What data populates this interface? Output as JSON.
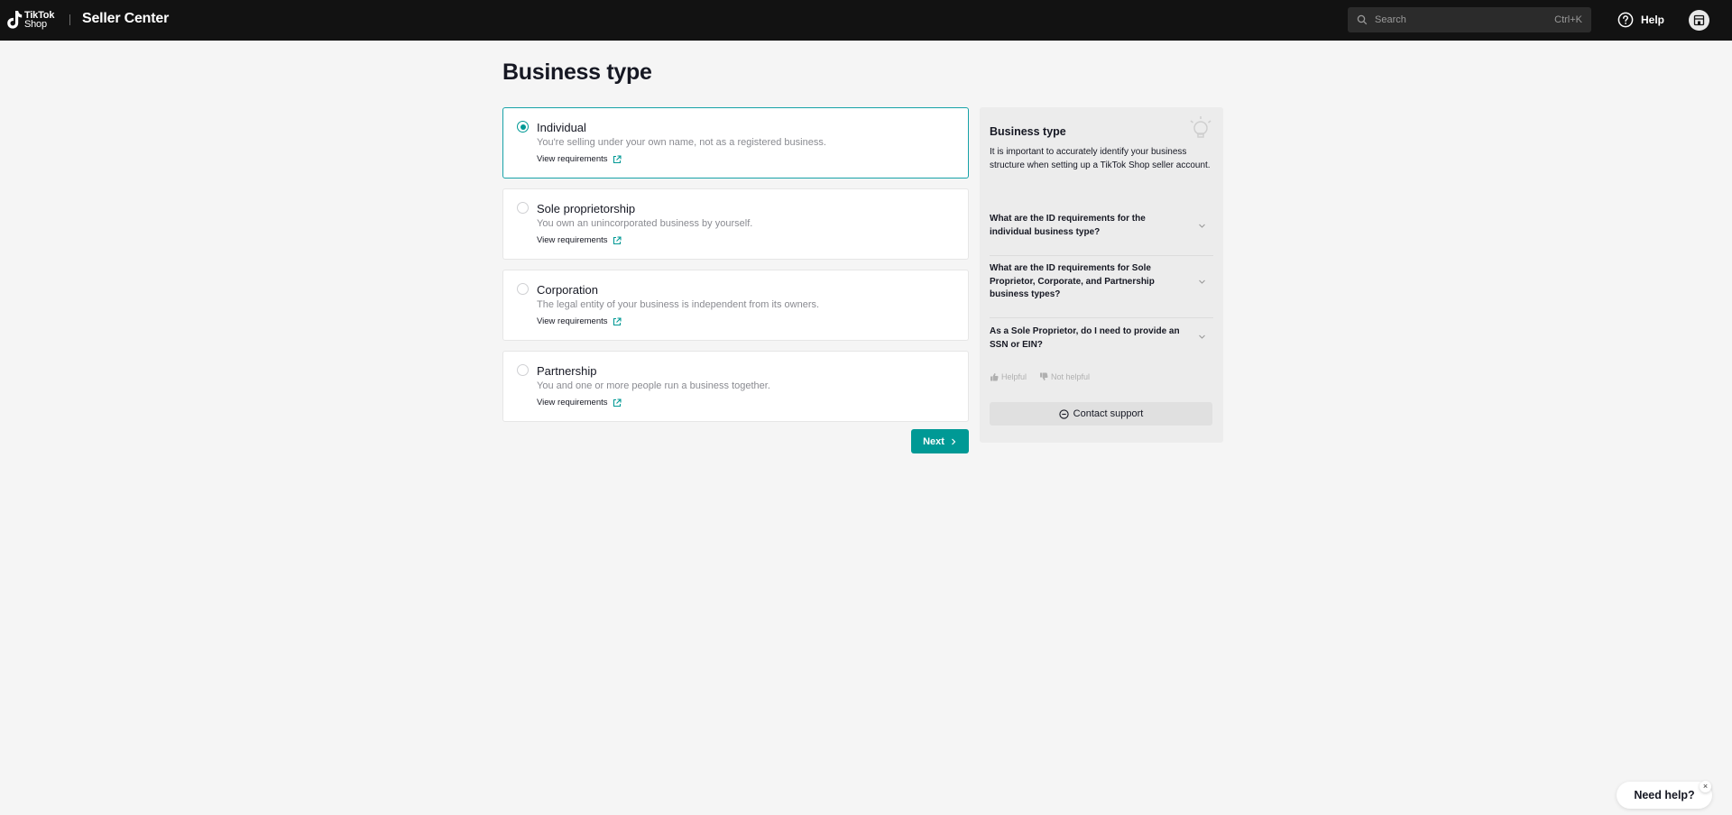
{
  "header": {
    "logo_line1": "TikTok",
    "logo_line2": "Shop",
    "app_title": "Seller Center",
    "search_placeholder": "Search",
    "search_shortcut": "Ctrl+K",
    "help_label": "Help"
  },
  "page": {
    "title": "Business type"
  },
  "options": [
    {
      "title": "Individual",
      "description": "You're selling under your own name, not as a registered business.",
      "link": "View requirements",
      "selected": true
    },
    {
      "title": "Sole proprietorship",
      "description": "You own an unincorporated business by yourself.",
      "link": "View requirements",
      "selected": false
    },
    {
      "title": "Corporation",
      "description": "The legal entity of your business is independent from its owners.",
      "link": "View requirements",
      "selected": false
    },
    {
      "title": "Partnership",
      "description": "You and one or more people run a business together.",
      "link": "View requirements",
      "selected": false
    }
  ],
  "next_label": "Next",
  "panel": {
    "title": "Business type",
    "description": "It is important to accurately identify your business structure when setting up a TikTok Shop seller account.",
    "faqs": [
      "What are the ID requirements for the individual business type?",
      "What are the ID requirements for Sole Proprietor, Corporate, and Partnership business types?",
      "As a Sole Proprietor, do I need to provide an SSN or EIN?"
    ],
    "helpful_label": "Helpful",
    "not_helpful_label": "Not helpful",
    "contact_label": "Contact support"
  },
  "need_help_label": "Need help?",
  "need_help_close": "×",
  "colors": {
    "accent": "#009995",
    "topbar": "#121212",
    "background": "#f5f5f5"
  }
}
